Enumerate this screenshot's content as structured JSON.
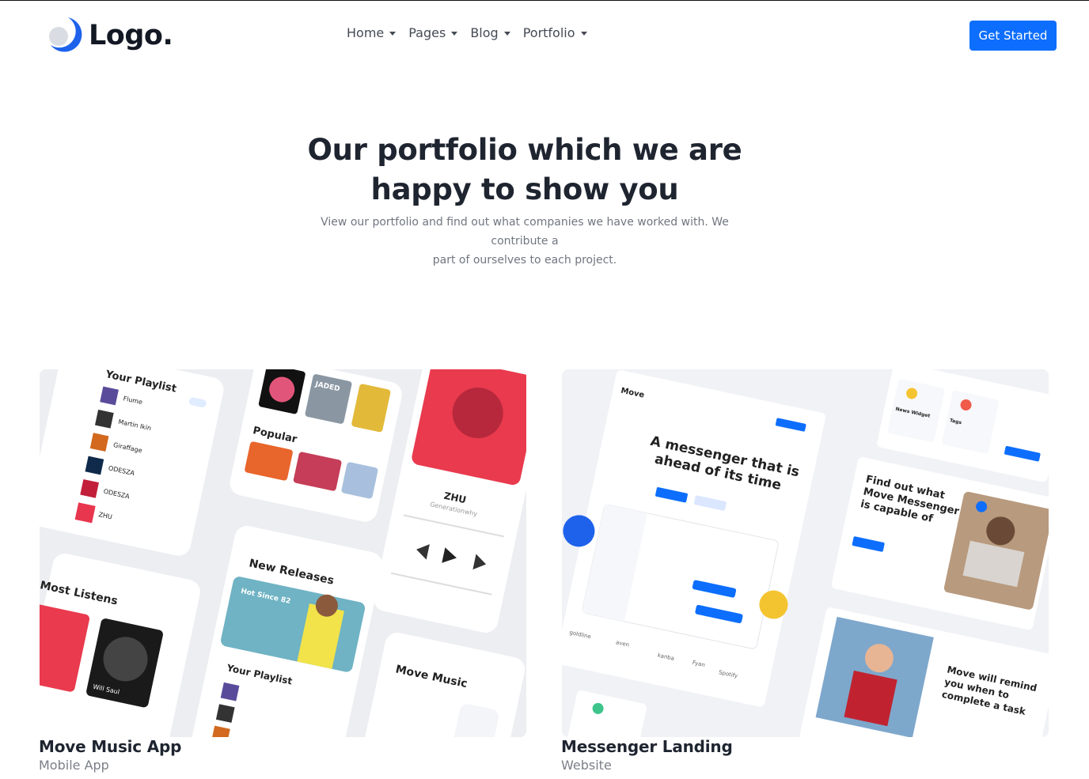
{
  "brand": {
    "name": "Logo.",
    "accent": "#0d6efd"
  },
  "nav": [
    {
      "label": "Home"
    },
    {
      "label": "Pages"
    },
    {
      "label": "Blog"
    },
    {
      "label": "Portfolio"
    }
  ],
  "cta": {
    "label": "Get Started"
  },
  "hero": {
    "title_line1": "Our portfolio which we are",
    "title_line2": "happy to show you",
    "subtitle_line1": "View our portfolio and find out what companies we have worked with. We contribute a",
    "subtitle_line2": "part of ourselves to each project."
  },
  "portfolio": [
    {
      "title": "Move Music App",
      "category": "Mobile App",
      "image_text": {
        "playlist": "Your Playlist",
        "popular": "Popular",
        "most_listens": "Most Listens",
        "new_releases": "New Releases",
        "hot_since": "Hot Since 82",
        "artist": "ZHU",
        "artist_sub": "Generationwhy",
        "move_music": "Move Music",
        "tracks": [
          "Flume",
          "Martin Ikin",
          "Giraffage",
          "ODESZA",
          "ODESZA",
          "ZHU"
        ],
        "album_1": "JADED",
        "album_2": "Will Saul"
      }
    },
    {
      "title": "Messenger Landing",
      "category": "Website",
      "image_text": {
        "brand": "Move",
        "headline_1": "A messenger that is",
        "headline_2": "ahead of its time",
        "find_out_1": "Find out what",
        "find_out_2": "Move Messenger",
        "find_out_3": "is capable of",
        "remind_1": "Move will remind",
        "remind_2": "you when to",
        "remind_3": "complete a task",
        "logos": [
          "goldline",
          "Fyan",
          "kanba",
          "Spotify",
          "aven"
        ],
        "news_widget": "News Widget",
        "tags": "Tags"
      }
    }
  ]
}
